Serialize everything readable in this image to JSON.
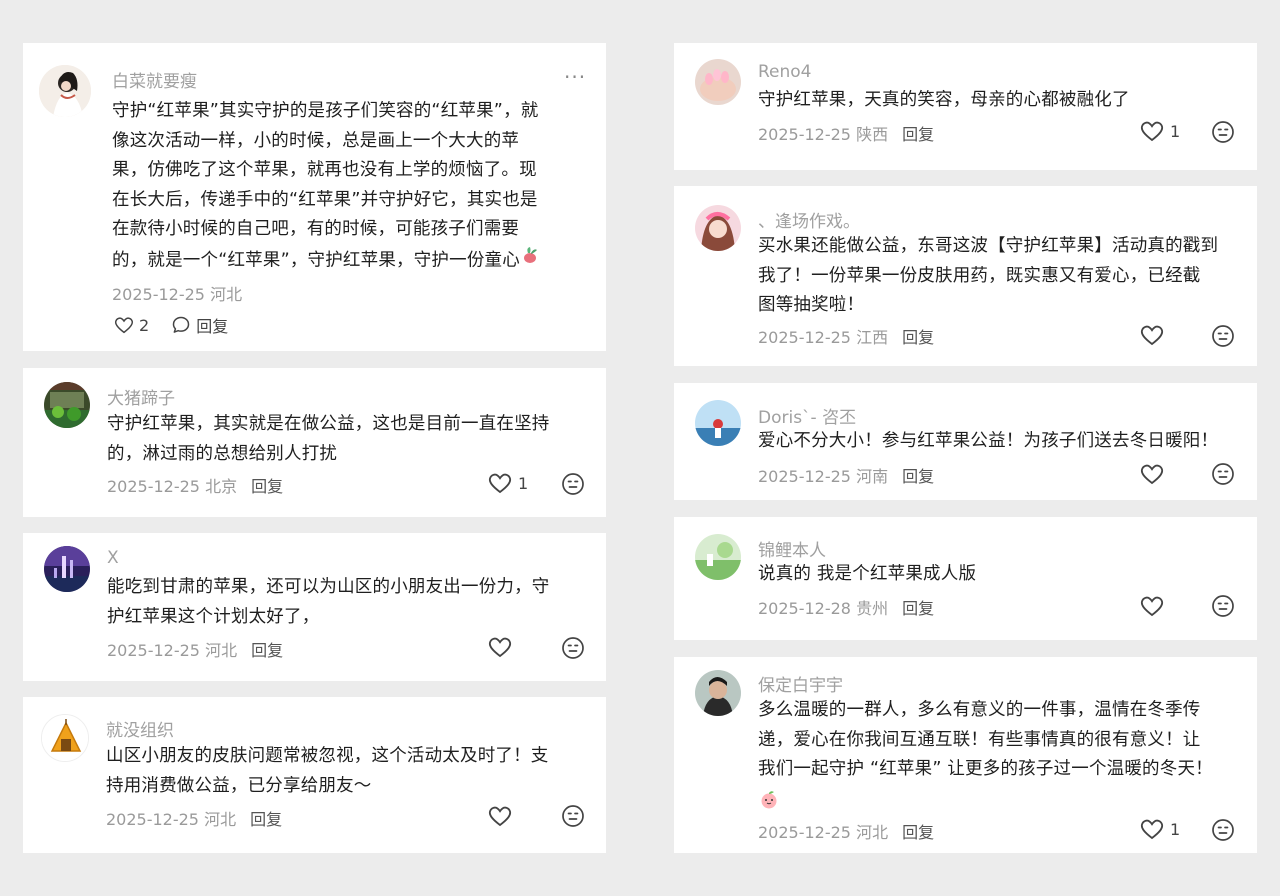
{
  "comments_left": [
    {
      "username": "白菜就要瘦",
      "lines": [
        "守护“红苹果”其实守护的是孩子们笑容的“红苹果”，就",
        "像这次活动一样，小的时候，总是画上一个大大的苹",
        "果，仿佛吃了这个苹果，就再也没有上学的烦恼了。现",
        "在长大后，传递手中的“红苹果”并守护好它，其实也是",
        "在款待小时候的自己吧，有的时候，可能孩子们需要",
        "的，就是一个“红苹果”，守护红苹果，守护一份童心"
      ],
      "meta": "2025-12-25 河北",
      "likes": "2",
      "reply": "回复",
      "more": "···"
    },
    {
      "username": "大猪蹄子",
      "lines": [
        "守护红苹果，其实就是在做公益，这也是目前一直在坚持",
        "的，淋过雨的总想给别人打扰"
      ],
      "meta": "2025-12-25 北京",
      "reply": "回复",
      "likes": "1"
    },
    {
      "username": "X",
      "lines": [
        "能吃到甘肃的苹果，还可以为山区的小朋友出一份力，守",
        "护红苹果这个计划太好了，"
      ],
      "meta": "2025-12-25 河北",
      "reply": "回复",
      "likes": ""
    },
    {
      "username": "就没组织",
      "lines": [
        "山区小朋友的皮肤问题常被忽视，这个活动太及时了！支",
        "持用消费做公益，已分享给朋友～"
      ],
      "meta": "2025-12-25 河北",
      "reply": "回复",
      "likes": ""
    }
  ],
  "comments_right": [
    {
      "username": "Reno4",
      "lines": [
        "守护红苹果，天真的笑容，母亲的心都被融化了"
      ],
      "meta": "2025-12-25 陕西",
      "reply": "回复",
      "likes": "1"
    },
    {
      "username": "、逢场作戏。",
      "lines": [
        "买水果还能做公益，东哥这波【守护红苹果】活动真的戳到",
        "我了！一份苹果一份皮肤用药，既实惠又有爱心，已经截",
        "图等抽奖啦！"
      ],
      "meta": "2025-12-25 江西",
      "reply": "回复",
      "likes": ""
    },
    {
      "username": "Doris`- 咨丕",
      "lines": [
        "爱心不分大小！参与红苹果公益！为孩子们送去冬日暖阳！"
      ],
      "meta": "2025-12-25 河南",
      "reply": "回复",
      "likes": ""
    },
    {
      "username": "锦鲤本人",
      "lines": [
        "说真的 我是个红苹果成人版"
      ],
      "meta": "2025-12-28 贵州",
      "reply": "回复",
      "likes": ""
    },
    {
      "username": "保定白宇宇",
      "lines": [
        "多么温暖的一群人，多么有意义的一件事，温情在冬季传",
        "递，爱心在你我间互通互联！有些事情真的很有意义！让",
        "我们一起守护 “红苹果” 让更多的孩子过一个温暖的冬天！"
      ],
      "meta": "2025-12-25 河北",
      "reply": "回复",
      "likes": "1"
    }
  ],
  "icons": {
    "heart": "heart-icon",
    "reaction": "emoji-reaction-icon",
    "comment": "comment-bubble-icon",
    "more": "more-dots-icon"
  }
}
